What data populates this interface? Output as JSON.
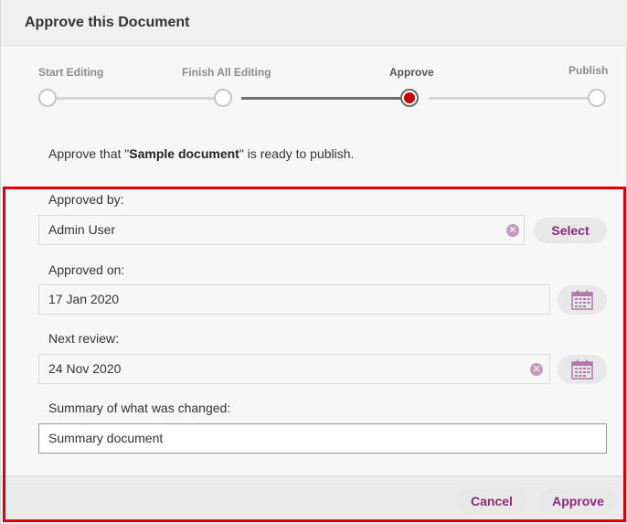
{
  "dialog": {
    "title": "Approve this Document"
  },
  "stepper": {
    "steps": [
      {
        "label": "Start Editing"
      },
      {
        "label": "Finish All Editing"
      },
      {
        "label": "Approve"
      },
      {
        "label": "Publish"
      }
    ],
    "current_step": "Approve",
    "colors": {
      "current": "#cc0000",
      "done_line": "#707070",
      "pending_line": "#d6d6d6"
    }
  },
  "intro": {
    "prefix": "Approve that \"",
    "document_name": "Sample document",
    "suffix": "\" is ready to publish."
  },
  "form": {
    "approved_by": {
      "label": "Approved by:",
      "value": "Admin User",
      "select_label": "Select"
    },
    "approved_on": {
      "label": "Approved on:",
      "value": "17 Jan 2020"
    },
    "next_review": {
      "label": "Next review:",
      "value": "24 Nov 2020"
    },
    "summary": {
      "label": "Summary of what was changed:",
      "value": "Summary document"
    }
  },
  "footer": {
    "cancel_label": "Cancel",
    "approve_label": "Approve"
  },
  "icons": {
    "clear": "clear-icon",
    "calendar": "calendar-icon"
  },
  "theme": {
    "accent": "#8b2a7a",
    "highlight_border": "#e00000"
  }
}
